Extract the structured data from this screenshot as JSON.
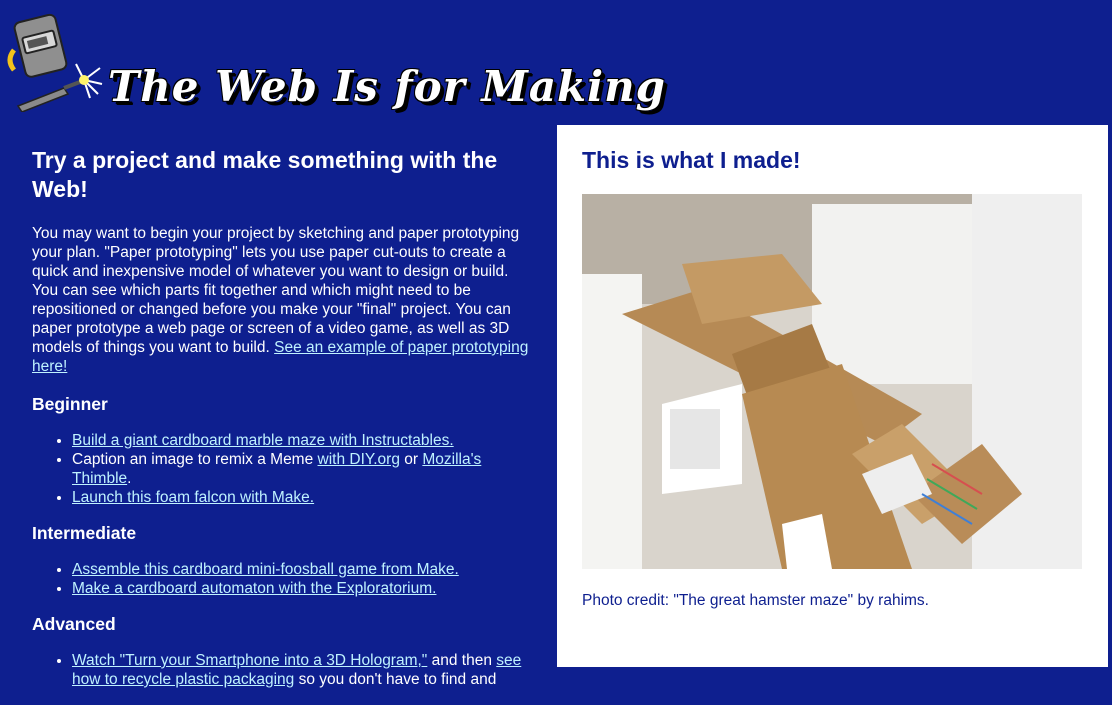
{
  "header": {
    "title": "The Web Is for Making",
    "logo_icon": "welding-mask-torch-icon"
  },
  "main": {
    "heading": "Try a project and make something with the Web!",
    "intro": "You may want to begin your project by sketching and paper prototyping your plan. \"Paper prototyping\" lets you use paper cut-outs to create a quick and inexpensive model of whatever you want to design or build. You can see which parts fit together and which might need to be repositioned or changed before you make your \"final\" project. You can paper prototype a web page or screen of a video game, as well as 3D models of things you want to build. ",
    "intro_link": "See an example of paper prototyping here!",
    "sections": {
      "beginner": {
        "heading": "Beginner",
        "item1_link": "Build a giant cardboard marble maze with Instructables.",
        "item2_text": "Caption an image to remix a Meme ",
        "item2_link1": "with DIY.org",
        "item2_or": " or ",
        "item2_link2": "Mozilla's Thimble",
        "item2_end": ".",
        "item3_link": "Launch this foam falcon with Make."
      },
      "intermediate": {
        "heading": "Intermediate",
        "item1_link": "Assemble this cardboard mini-foosball game from Make.",
        "item2_link": "Make a cardboard automaton with the Exploratorium."
      },
      "advanced": {
        "heading": "Advanced",
        "item1_link": "Watch \"Turn your Smartphone into a 3D Hologram,\"",
        "item1_mid": " and then ",
        "item1_link2": "see how to recycle plastic packaging",
        "item1_end": " so you don't have to find and"
      }
    }
  },
  "showcase": {
    "heading": "This is what I made!",
    "photo_alt": "cardboard hamster maze",
    "credit": "Photo credit: \"The great hamster maze\" by rahims."
  },
  "colors": {
    "background": "#0e1f8f",
    "link": "#bff2ff",
    "card": "#ffffff"
  }
}
